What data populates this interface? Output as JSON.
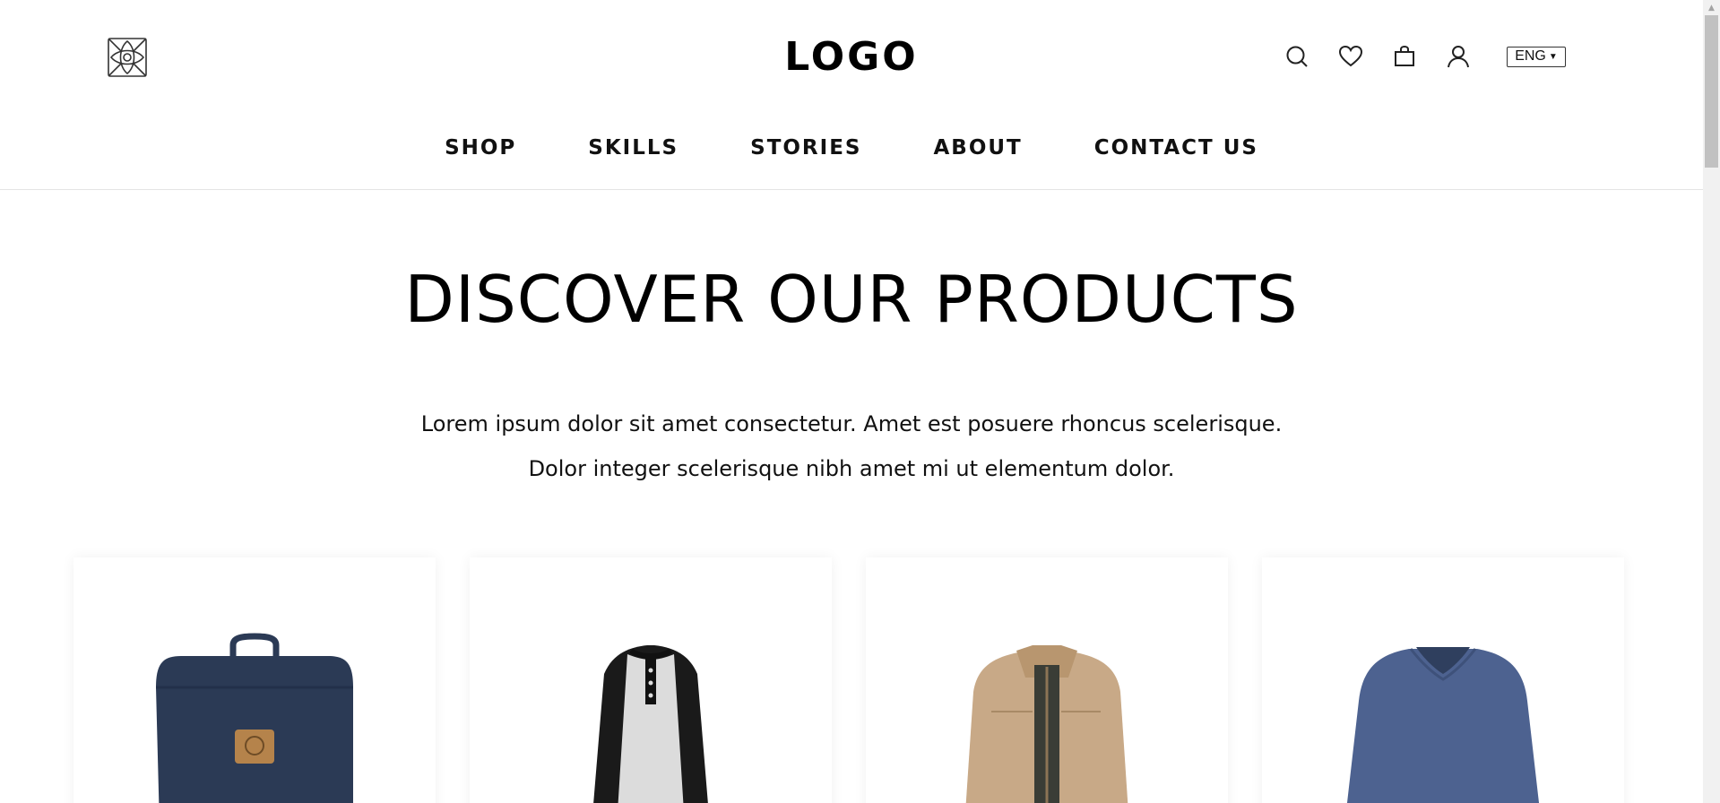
{
  "header": {
    "logo_text": "LOGO",
    "brand_mark_icon": "celtic-knot-icon",
    "icons": [
      "search-icon",
      "heart-icon",
      "shopping-bag-icon",
      "user-icon"
    ],
    "language": {
      "selected": "ENG"
    }
  },
  "nav": {
    "items": [
      {
        "label": "SHOP"
      },
      {
        "label": "SKILLS"
      },
      {
        "label": "STORIES"
      },
      {
        "label": "ABOUT"
      },
      {
        "label": "CONTACT US"
      }
    ]
  },
  "hero": {
    "title": "DISCOVER OUR PRODUCTS",
    "line1": "Lorem ipsum dolor sit amet consectetur. Amet est posuere rhoncus scelerisque.",
    "line2": "Dolor integer scelerisque nibh amet mi ut elementum dolor."
  },
  "products": [
    {
      "image": "navy-backpack",
      "color": "#2b3a55"
    },
    {
      "image": "raglan-henley-tshirt",
      "color": "#1a1a1a"
    },
    {
      "image": "khaki-jacket",
      "color": "#c8a987"
    },
    {
      "image": "blue-vneck-sweater",
      "color": "#4d6290"
    }
  ],
  "colors": {
    "text": "#111111",
    "divider": "#e4e4e4",
    "background": "#ffffff"
  }
}
